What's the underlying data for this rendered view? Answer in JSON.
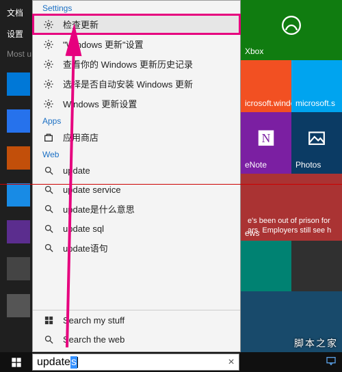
{
  "start_sidebar": {
    "item1": "文档",
    "item2": "设置",
    "most_used": "Most u"
  },
  "tiles": {
    "xbox": "Xbox",
    "ms1": "icrosoft.windo",
    "ms2": "microsoft.s",
    "onenote": "eNote",
    "photos": "Photos",
    "news_headline": "e's been out of prison for ars. Employers still see h",
    "news_label": "ews"
  },
  "search": {
    "hdr_settings": "Settings",
    "settings": [
      "检查更新",
      "\"Windows 更新\"设置",
      "查看你的 Windows 更新历史记录",
      "选择是否自动安装 Windows 更新",
      "Windows 更新设置"
    ],
    "hdr_apps": "Apps",
    "apps": [
      "应用商店"
    ],
    "hdr_web": "Web",
    "web": [
      "update",
      "update service",
      "update是什么意思",
      "update sql",
      "update语句"
    ],
    "my_stuff": "Search my stuff",
    "the_web": "Search the web"
  },
  "searchbox": {
    "prefix": "update",
    "selected": "s",
    "clear": "×"
  },
  "watermark": "脚本之家"
}
